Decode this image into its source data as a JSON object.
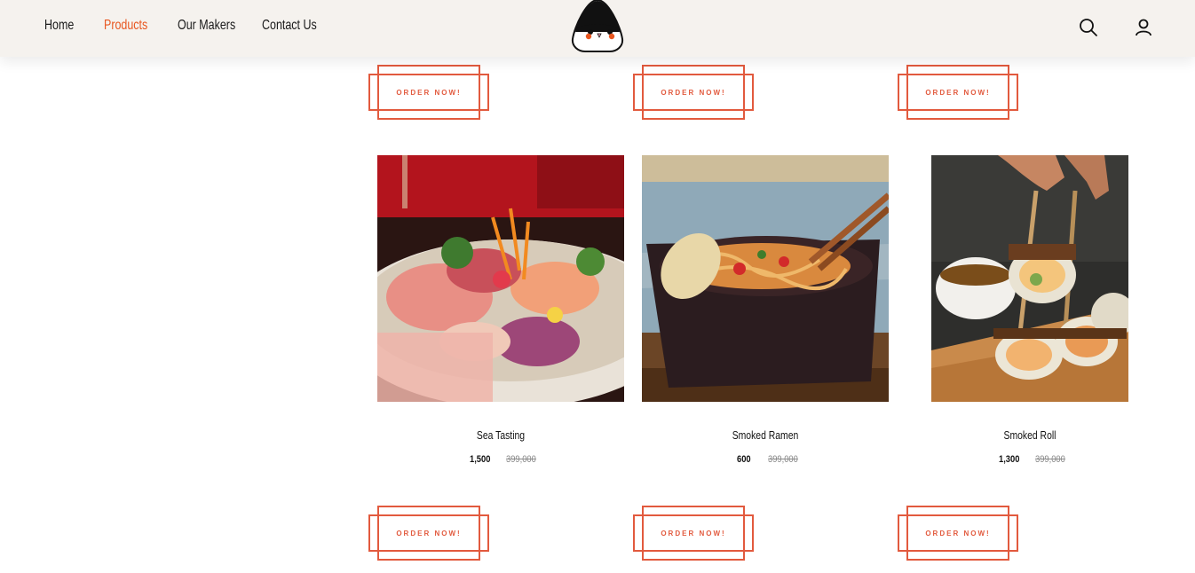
{
  "nav": {
    "home": "Home",
    "products": "Products",
    "makers": "Our Makers",
    "contact": "Contact Us"
  },
  "colors": {
    "accent": "#e8561f",
    "button": "#e25a3e",
    "header_bg": "#f5f2ee"
  },
  "header": {
    "search_icon": "search-icon",
    "account_icon": "user-icon",
    "logo": "onigiri-logo"
  },
  "order_label": "ORDER NOW!",
  "products": [
    {
      "name": "Sea Tasting",
      "price": "1,500",
      "old_price": "399,000"
    },
    {
      "name": "Smoked Ramen",
      "price": "600",
      "old_price": "399,000"
    },
    {
      "name": "Smoked Roll",
      "price": "1,300",
      "old_price": "399,000"
    }
  ]
}
